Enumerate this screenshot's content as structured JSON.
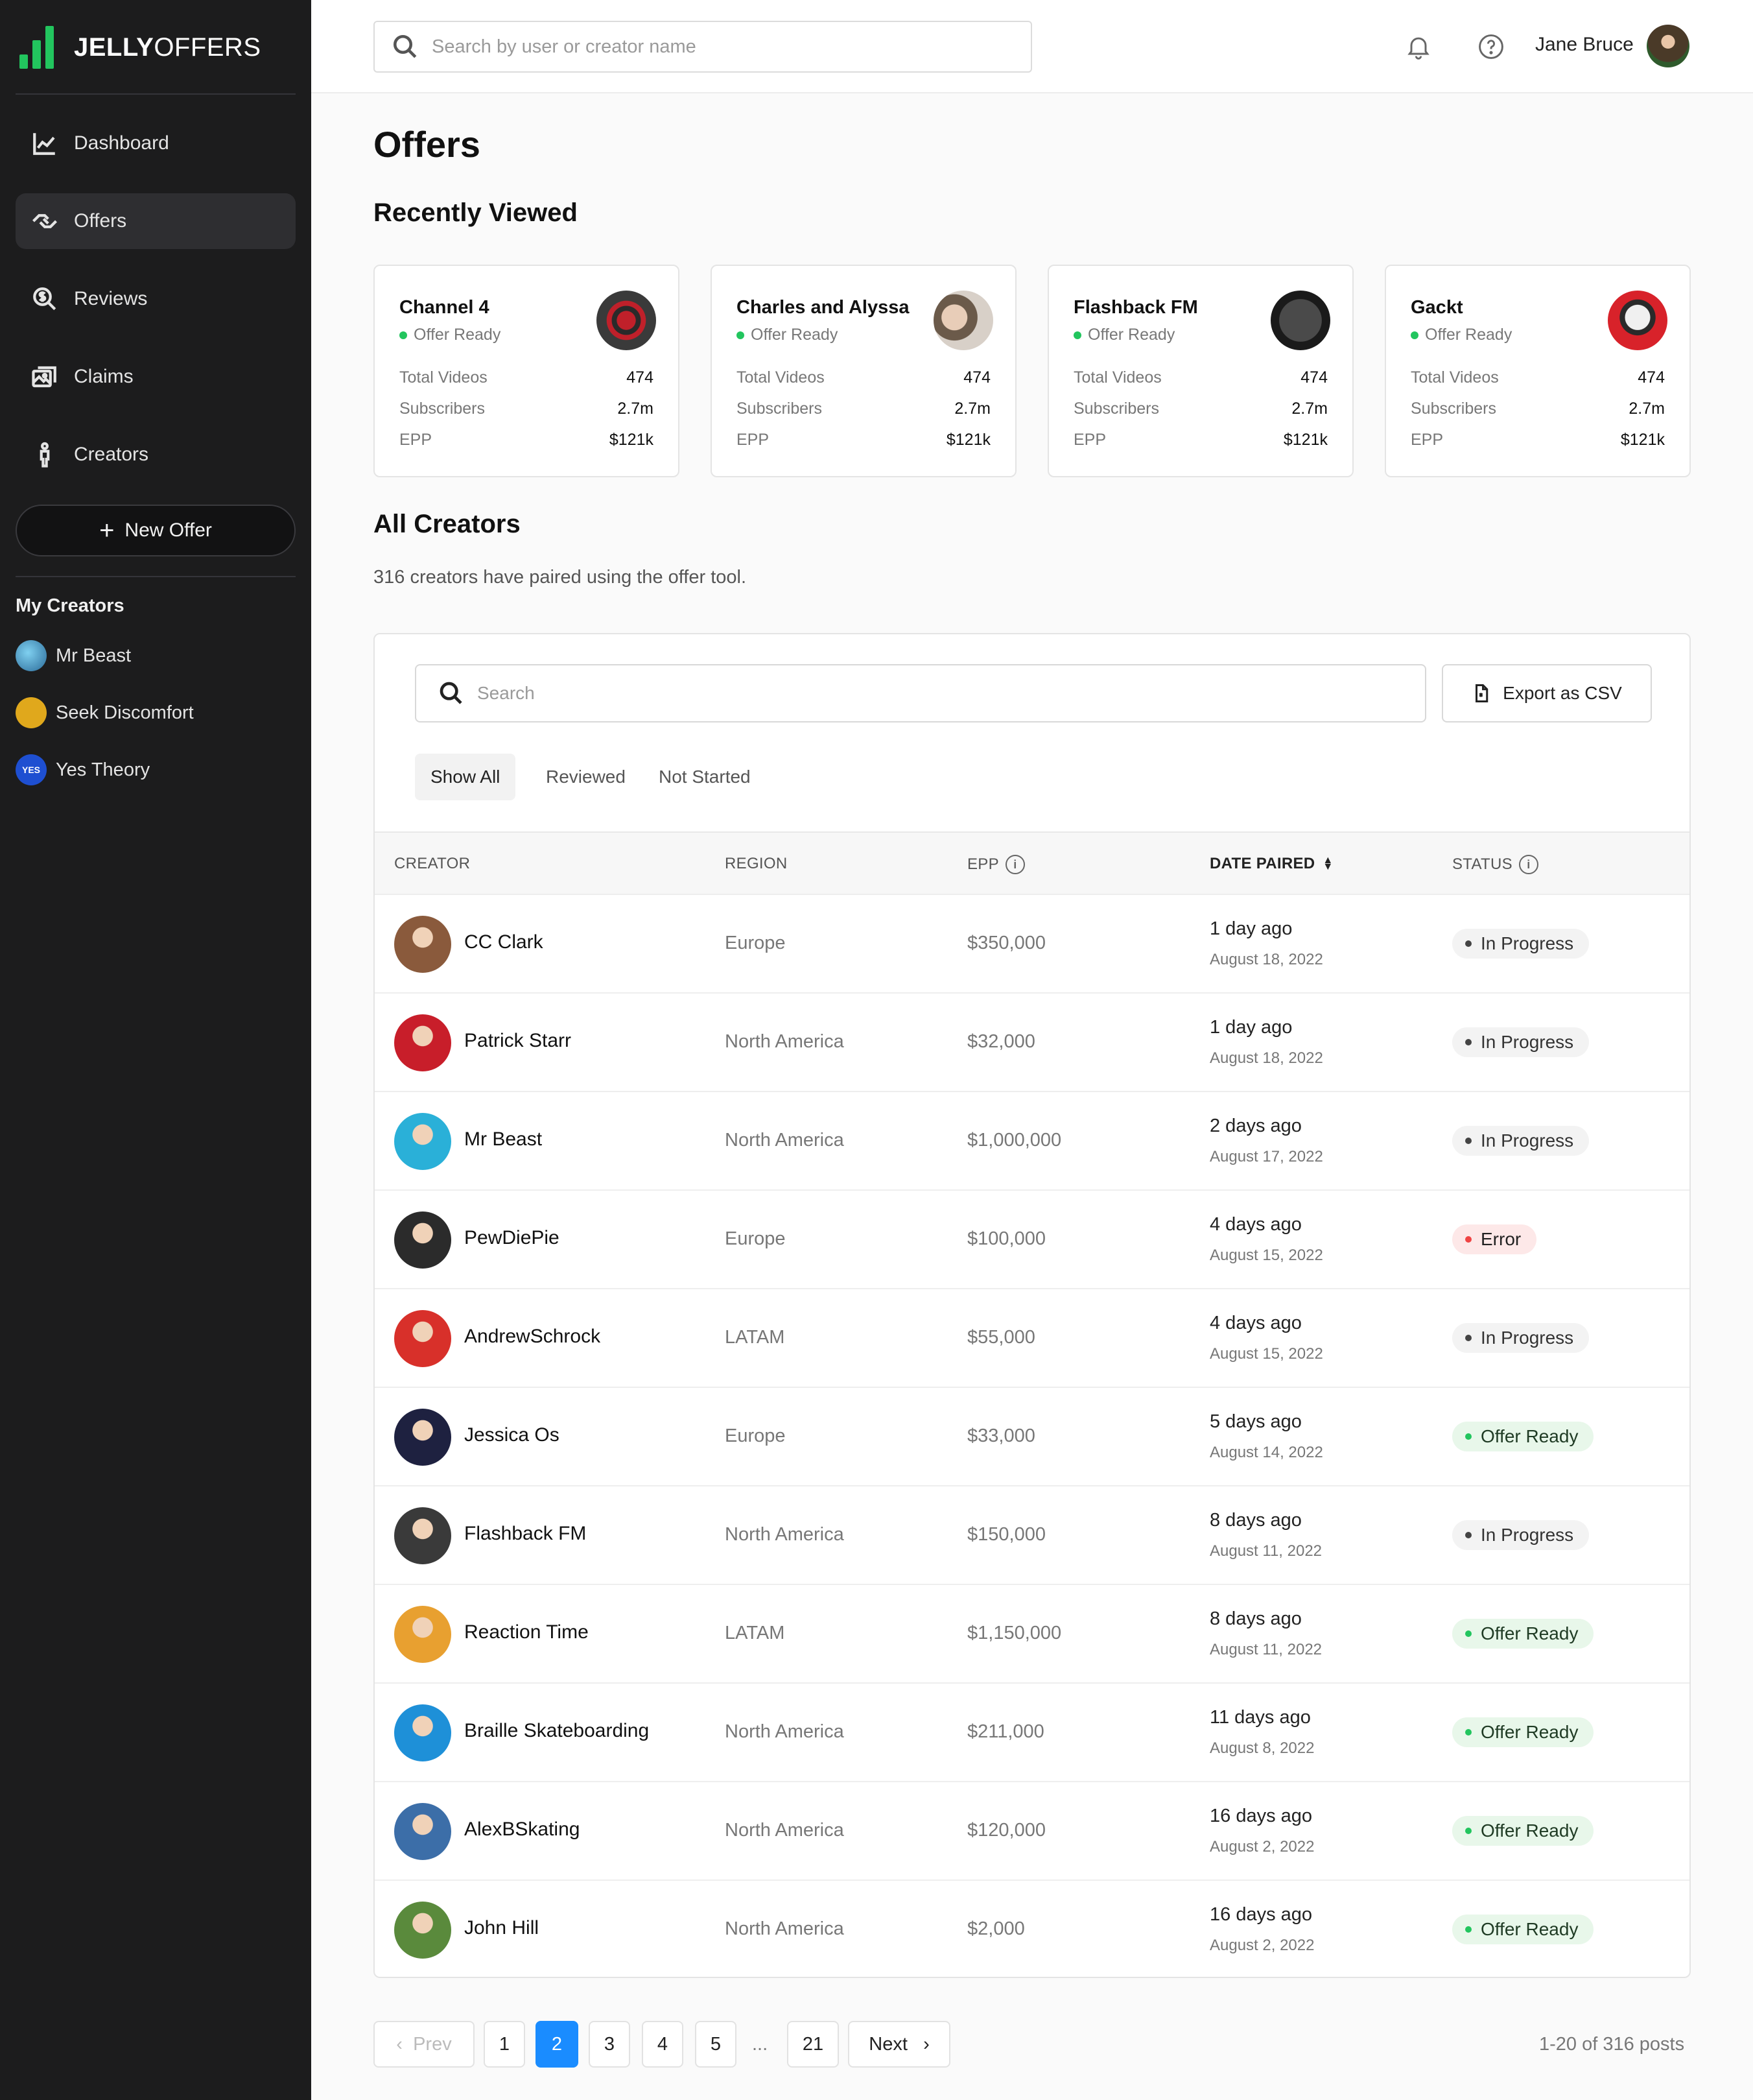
{
  "brand": {
    "bold": "JELLY",
    "light": "OFFERS"
  },
  "nav": [
    {
      "label": "Dashboard",
      "icon": "chart-line-icon",
      "active": false
    },
    {
      "label": "Offers",
      "icon": "handshake-icon",
      "active": true
    },
    {
      "label": "Reviews",
      "icon": "search-dollar-icon",
      "active": false
    },
    {
      "label": "Claims",
      "icon": "images-icon",
      "active": false
    },
    {
      "label": "Creators",
      "icon": "person-icon",
      "active": false
    }
  ],
  "new_offer_label": "New Offer",
  "my_creators": {
    "title": "My Creators",
    "items": [
      {
        "name": "Mr Beast",
        "color": "#3b8fb8"
      },
      {
        "name": "Seek Discomfort",
        "color": "#e0a81c"
      },
      {
        "name": "Yes Theory",
        "color": "#1e4fd1",
        "badge": "YES"
      }
    ]
  },
  "header": {
    "search_placeholder": "Search by user or creator name",
    "user_name": "Jane Bruce"
  },
  "page_title": "Offers",
  "recently_viewed": {
    "title": "Recently Viewed",
    "cards": [
      {
        "name": "Channel 4",
        "status": "Offer Ready",
        "videos_label": "Total Videos",
        "videos": "474",
        "subs_label": "Subscribers",
        "subs": "2.7m",
        "epp_label": "EPP",
        "epp": "$121k",
        "avatar_color": "#2a2a2a"
      },
      {
        "name": "Charles and Alyssa",
        "status": "Offer Ready",
        "videos_label": "Total Videos",
        "videos": "474",
        "subs_label": "Subscribers",
        "subs": "2.7m",
        "epp_label": "EPP",
        "epp": "$121k",
        "avatar_color": "#c9b8a8"
      },
      {
        "name": "Flashback FM",
        "status": "Offer Ready",
        "videos_label": "Total Videos",
        "videos": "474",
        "subs_label": "Subscribers",
        "subs": "2.7m",
        "epp_label": "EPP",
        "epp": "$121k",
        "avatar_color": "#333333"
      },
      {
        "name": "Gackt",
        "status": "Offer Ready",
        "videos_label": "Total Videos",
        "videos": "474",
        "subs_label": "Subscribers",
        "subs": "2.7m",
        "epp_label": "EPP",
        "epp": "$121k",
        "avatar_color": "#d8222a"
      }
    ]
  },
  "all_creators": {
    "title": "All Creators",
    "subtitle": "316 creators have paired using the offer tool.",
    "search_placeholder": "Search",
    "export_label": "Export as CSV",
    "filters": [
      "Show All",
      "Reviewed",
      "Not Started"
    ],
    "columns": [
      "CREATOR",
      "REGION",
      "EPP",
      "DATE PAIRED",
      "STATUS"
    ],
    "rows": [
      {
        "name": "CC Clark",
        "region": "Europe",
        "epp": "$350,000",
        "ago": "1 day ago",
        "date": "August 18, 2022",
        "status": "In Progress",
        "status_type": "progress",
        "avatar_color": "#8a5a3c"
      },
      {
        "name": "Patrick Starr",
        "region": "North America",
        "epp": "$32,000",
        "ago": "1 day ago",
        "date": "August 18, 2022",
        "status": "In Progress",
        "status_type": "progress",
        "avatar_color": "#c81e2a"
      },
      {
        "name": "Mr Beast",
        "region": "North America",
        "epp": "$1,000,000",
        "ago": "2 days ago",
        "date": "August 17, 2022",
        "status": "In Progress",
        "status_type": "progress",
        "avatar_color": "#2ab0d8"
      },
      {
        "name": "PewDiePie",
        "region": "Europe",
        "epp": "$100,000",
        "ago": "4 days ago",
        "date": "August 15, 2022",
        "status": "Error",
        "status_type": "error",
        "avatar_color": "#2b2b2b"
      },
      {
        "name": "AndrewSchrock",
        "region": "LATAM",
        "epp": "$55,000",
        "ago": "4 days ago",
        "date": "August 15, 2022",
        "status": "In Progress",
        "status_type": "progress",
        "avatar_color": "#d8302a"
      },
      {
        "name": "Jessica Os",
        "region": "Europe",
        "epp": "$33,000",
        "ago": "5 days ago",
        "date": "August 14, 2022",
        "status": "Offer Ready",
        "status_type": "ready",
        "avatar_color": "#1e2140"
      },
      {
        "name": "Flashback FM",
        "region": "North America",
        "epp": "$150,000",
        "ago": "8 days ago",
        "date": "August 11, 2022",
        "status": "In Progress",
        "status_type": "progress",
        "avatar_color": "#3a3a3a"
      },
      {
        "name": "Reaction Time",
        "region": "LATAM",
        "epp": "$1,150,000",
        "ago": "8 days ago",
        "date": "August 11, 2022",
        "status": "Offer Ready",
        "status_type": "ready",
        "avatar_color": "#e8a030"
      },
      {
        "name": "Braille Skateboarding",
        "region": "North America",
        "epp": "$211,000",
        "ago": "11 days ago",
        "date": "August 8, 2022",
        "status": "Offer Ready",
        "status_type": "ready",
        "avatar_color": "#1e90d8"
      },
      {
        "name": "AlexBSkating",
        "region": "North America",
        "epp": "$120,000",
        "ago": "16 days ago",
        "date": "August 2, 2022",
        "status": "Offer Ready",
        "status_type": "ready",
        "avatar_color": "#3c6ea8"
      },
      {
        "name": "John Hill",
        "region": "North America",
        "epp": "$2,000",
        "ago": "16 days ago",
        "date": "August 2, 2022",
        "status": "Offer Ready",
        "status_type": "ready",
        "avatar_color": "#5a8a3c"
      }
    ]
  },
  "pagination": {
    "prev": "Prev",
    "next": "Next",
    "pages": [
      "1",
      "2",
      "3",
      "4",
      "5"
    ],
    "ellipsis": "...",
    "last": "21",
    "current": "2",
    "summary": "1-20 of 316 posts"
  }
}
